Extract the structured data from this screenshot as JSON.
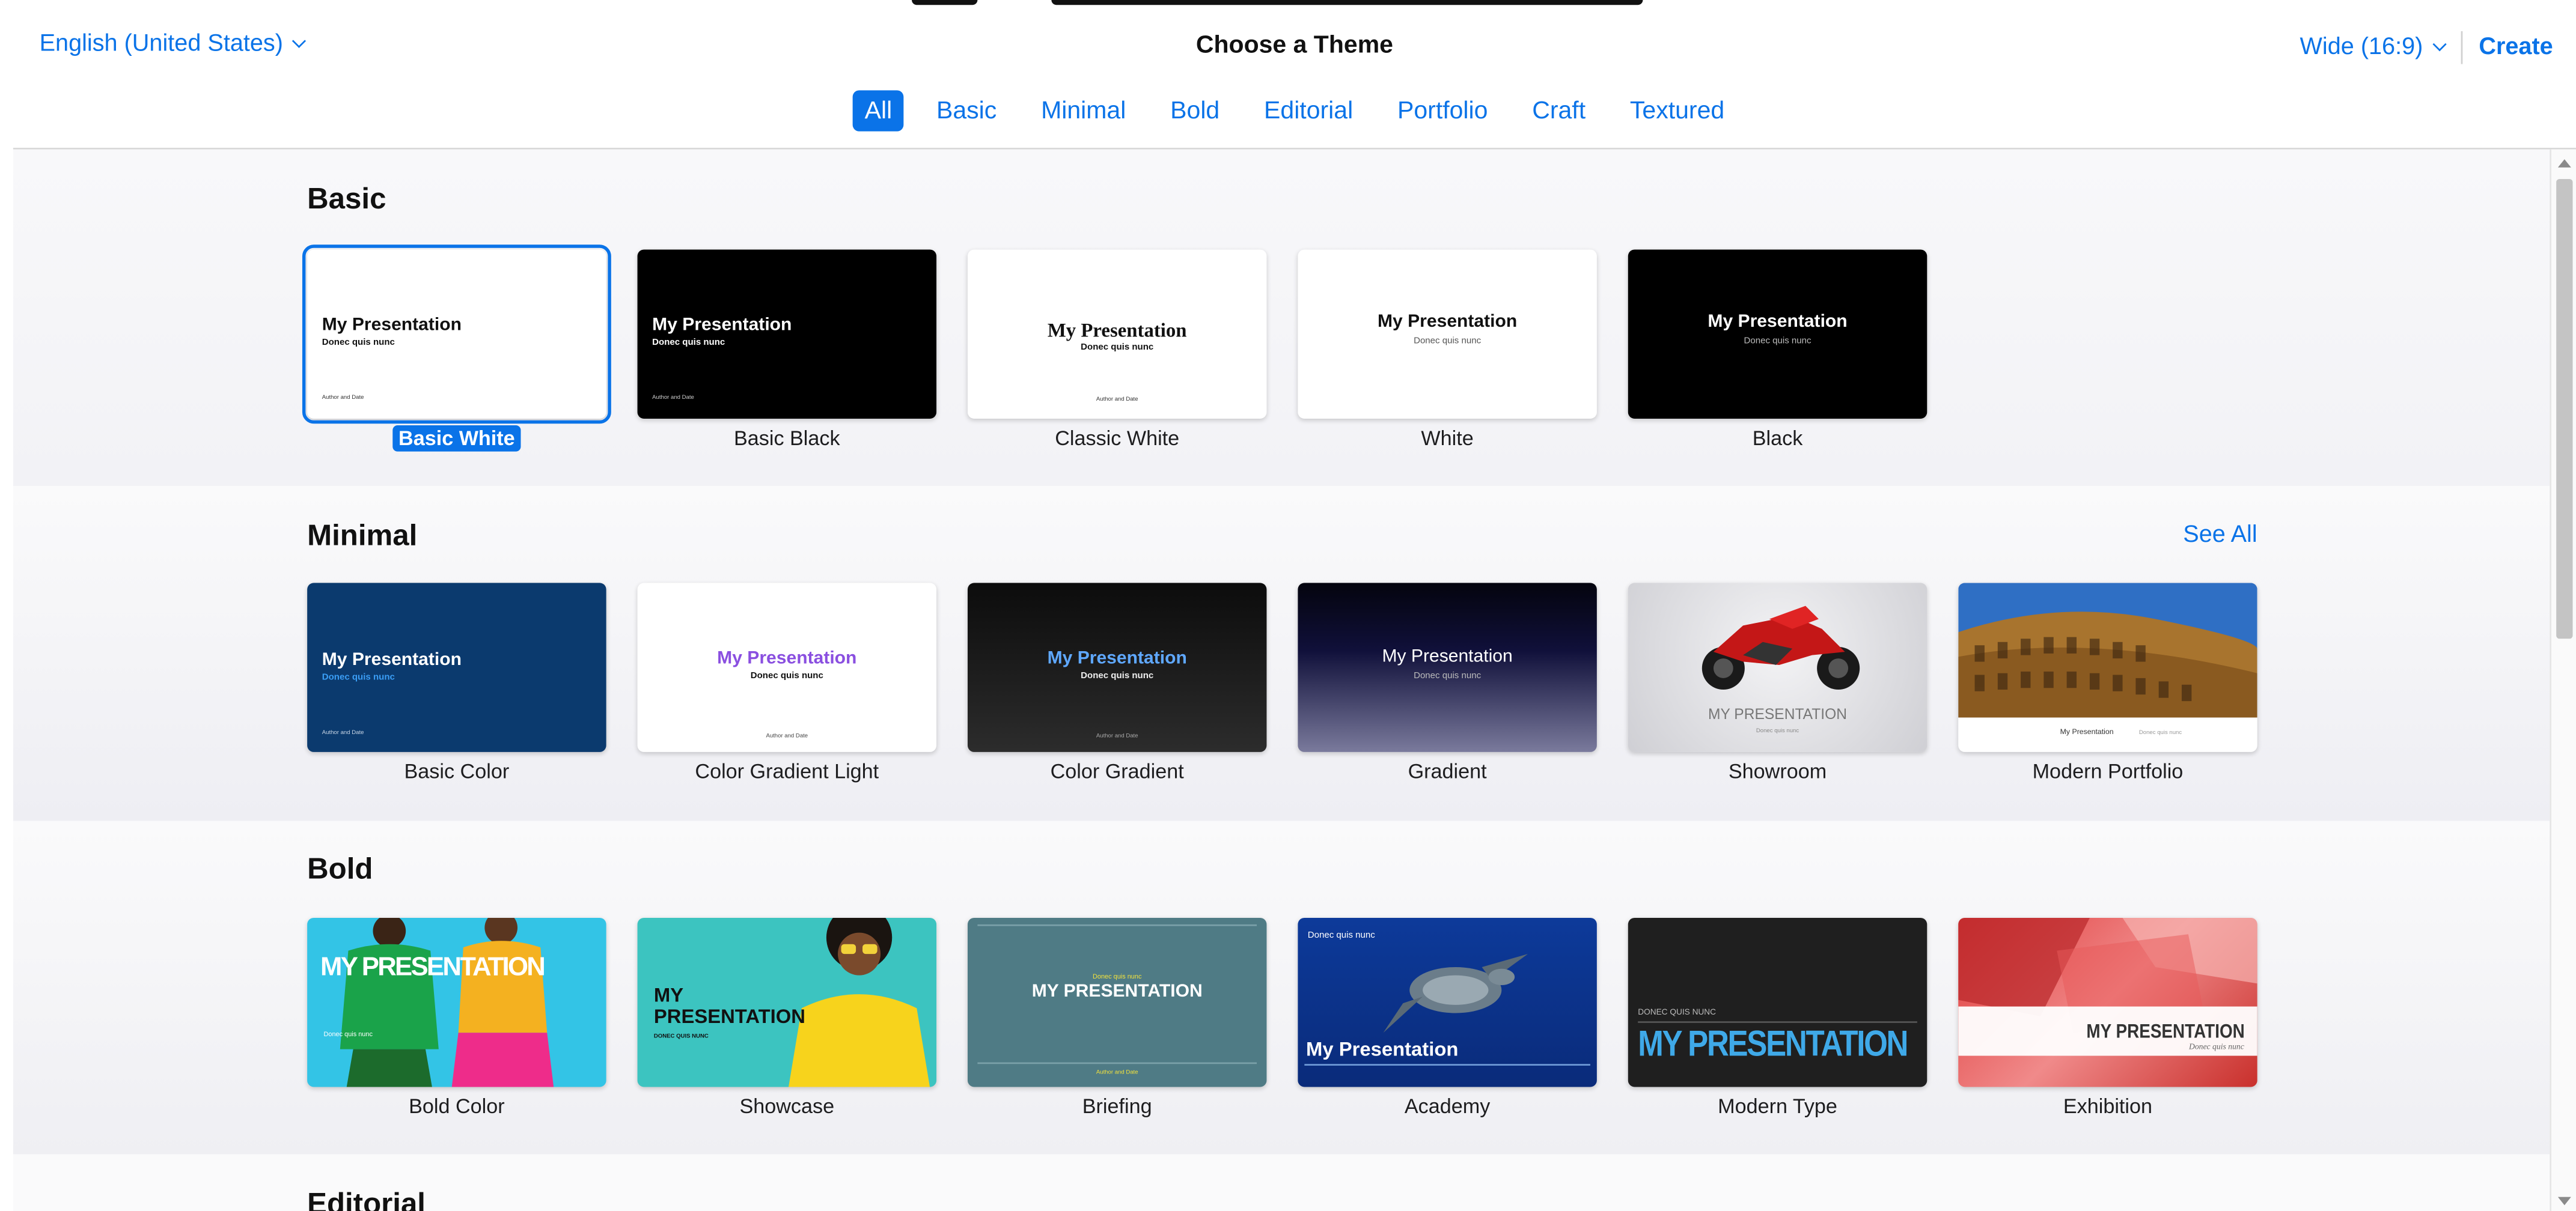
{
  "header": {
    "language": "English (United States)",
    "title": "Choose a Theme",
    "aspect": "Wide (16:9)",
    "create": "Create"
  },
  "filters": [
    "All",
    "Basic",
    "Minimal",
    "Bold",
    "Editorial",
    "Portfolio",
    "Craft",
    "Textured"
  ],
  "active_filter": "All",
  "sections": {
    "basic": {
      "title": "Basic"
    },
    "minimal": {
      "title": "Minimal",
      "see_all": "See All"
    },
    "bold": {
      "title": "Bold"
    },
    "editorial": {
      "title": "Editorial"
    }
  },
  "themes": {
    "basic_white": {
      "name": "Basic White",
      "slide_title": "My Presentation",
      "subtitle": "Donec quis nunc",
      "author": "Author and Date"
    },
    "basic_black": {
      "name": "Basic Black",
      "slide_title": "My Presentation",
      "subtitle": "Donec quis nunc",
      "author": "Author and Date"
    },
    "classic_white": {
      "name": "Classic White",
      "slide_title": "My Presentation",
      "subtitle": "Donec quis nunc",
      "author": "Author and Date"
    },
    "white": {
      "name": "White",
      "slide_title": "My Presentation",
      "subtitle": "Donec quis nunc"
    },
    "black": {
      "name": "Black",
      "slide_title": "My Presentation",
      "subtitle": "Donec quis nunc"
    },
    "basic_color": {
      "name": "Basic Color",
      "slide_title": "My Presentation",
      "subtitle": "Donec quis nunc",
      "author": "Author and Date"
    },
    "color_gradient_light": {
      "name": "Color Gradient Light",
      "slide_title": "My Presentation",
      "subtitle": "Donec quis nunc",
      "author": "Author and Date"
    },
    "color_gradient": {
      "name": "Color Gradient",
      "slide_title": "My Presentation",
      "subtitle": "Donec quis nunc",
      "author": "Author and Date"
    },
    "gradient": {
      "name": "Gradient",
      "slide_title": "My Presentation",
      "subtitle": "Donec quis nunc"
    },
    "showroom": {
      "name": "Showroom",
      "slide_title": "MY PRESENTATION",
      "subtitle": "Donec quis nunc"
    },
    "modern_portfolio": {
      "name": "Modern Portfolio",
      "slide_title": "My Presentation",
      "subtitle": "Donec quis nunc"
    },
    "bold_color": {
      "name": "Bold Color",
      "slide_title": "MY PRESENTATION",
      "subtitle": "Donec quis nunc"
    },
    "showcase": {
      "name": "Showcase",
      "slide_title_1": "MY",
      "slide_title_2": "PRESENTATION",
      "subtitle": "DONEC QUIS NUNC"
    },
    "briefing": {
      "name": "Briefing",
      "slide_title": "MY PRESENTATION",
      "subtitle": "Donec quis nunc",
      "author": "Author and Date"
    },
    "academy": {
      "name": "Academy",
      "kicker": "Donec quis nunc",
      "slide_title": "My Presentation"
    },
    "modern_type": {
      "name": "Modern Type",
      "kicker": "DONEC QUIS NUNC",
      "slide_title": "MY PRESENTATION"
    },
    "exhibition": {
      "name": "Exhibition",
      "slide_title": "MY PRESENTATION",
      "subtitle": "Donec quis nunc"
    }
  },
  "colors": {
    "accent": "#0a73e8"
  }
}
